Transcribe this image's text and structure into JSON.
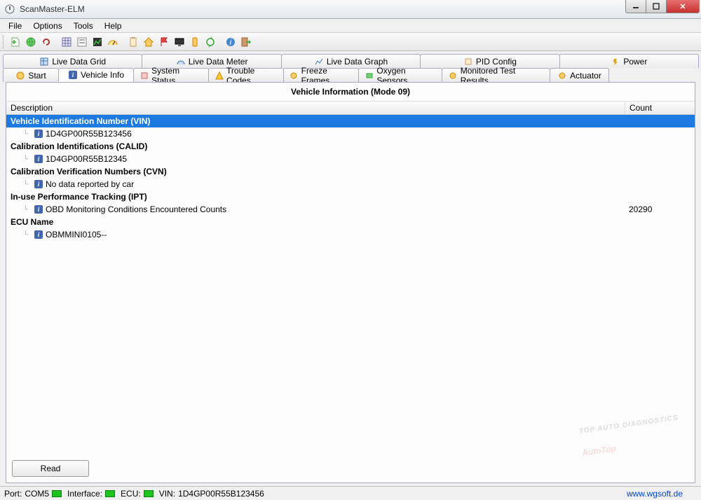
{
  "window": {
    "title": "ScanMaster-ELM"
  },
  "menu": {
    "file": "File",
    "options": "Options",
    "tools": "Tools",
    "help": "Help"
  },
  "tabs_top": [
    {
      "label": "Live Data Grid"
    },
    {
      "label": "Live Data Meter"
    },
    {
      "label": "Live Data Graph"
    },
    {
      "label": "PID Config"
    },
    {
      "label": "Power"
    }
  ],
  "tabs_bottom": [
    {
      "label": "Start"
    },
    {
      "label": "Vehicle Info"
    },
    {
      "label": "System Status"
    },
    {
      "label": "Trouble Codes"
    },
    {
      "label": "Freeze Frames"
    },
    {
      "label": "Oxygen Sensors"
    },
    {
      "label": "Monitored Test Results"
    },
    {
      "label": "Actuator"
    }
  ],
  "panel": {
    "title": "Vehicle Information (Mode 09)",
    "col_desc": "Description",
    "col_count": "Count",
    "read_btn": "Read"
  },
  "tree": [
    {
      "type": "header",
      "desc": "Vehicle Identification Number (VIN)",
      "count": "",
      "selected": true
    },
    {
      "type": "child",
      "desc": "1D4GP00R55B123456",
      "count": ""
    },
    {
      "type": "header",
      "desc": "Calibration Identifications (CALID)",
      "count": ""
    },
    {
      "type": "child",
      "desc": "1D4GP00R55B12345",
      "count": ""
    },
    {
      "type": "header",
      "desc": "Calibration Verification Numbers (CVN)",
      "count": ""
    },
    {
      "type": "child",
      "desc": "No data reported by car",
      "count": ""
    },
    {
      "type": "header",
      "desc": "In-use Performance Tracking (IPT)",
      "count": ""
    },
    {
      "type": "child",
      "desc": "OBD Monitoring Conditions Encountered Counts",
      "count": "20290"
    },
    {
      "type": "header",
      "desc": "ECU Name",
      "count": ""
    },
    {
      "type": "child",
      "desc": "OBMMINI0105--",
      "count": ""
    }
  ],
  "status": {
    "port_label": "Port:",
    "port_value": "COM5",
    "interface_label": "Interface:",
    "ecu_label": "ECU:",
    "vin_label": "VIN:",
    "vin_value": "1D4GP00R55B123456",
    "link": "www.wgsoft.de"
  },
  "watermark": {
    "main": "AutoTop",
    "sub": "TOP AUTO DIAGNOSTICS"
  }
}
